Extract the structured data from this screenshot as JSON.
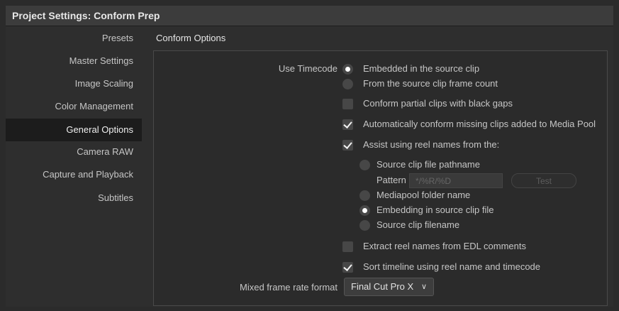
{
  "window": {
    "title": "Project Settings:  Conform Prep"
  },
  "sidebar": {
    "items": [
      {
        "label": "Presets",
        "active": false
      },
      {
        "label": "Master Settings",
        "active": false
      },
      {
        "label": "Image Scaling",
        "active": false
      },
      {
        "label": "Color Management",
        "active": false
      },
      {
        "label": "General Options",
        "active": true
      },
      {
        "label": "Camera RAW",
        "active": false
      },
      {
        "label": "Capture and Playback",
        "active": false
      },
      {
        "label": "Subtitles",
        "active": false
      }
    ]
  },
  "content": {
    "section_title": "Conform Options",
    "use_timecode": {
      "label": "Use Timecode",
      "options": [
        "Embedded in the source clip",
        "From the source clip frame count"
      ],
      "selected": "Embedded in the source clip"
    },
    "conform_partial_clips": {
      "label": "Conform partial clips with black gaps",
      "checked": false
    },
    "auto_conform_missing": {
      "label": "Automatically conform missing clips added to Media Pool",
      "checked": true
    },
    "assist_reel_names": {
      "label": "Assist using reel names from the:",
      "checked": true,
      "options": [
        "Source clip file pathname",
        "Mediapool folder name",
        "Embedding in source clip file",
        "Source clip filename"
      ],
      "selected": "Embedding in source clip file",
      "pattern_label": "Pattern",
      "pattern_value": "*/%R/%D",
      "test_label": "Test"
    },
    "extract_reel_names_edl": {
      "label": "Extract reel names from EDL comments",
      "checked": false
    },
    "sort_timeline": {
      "label": "Sort timeline using reel name and timecode",
      "checked": true
    },
    "mixed_frame_rate": {
      "label": "Mixed frame rate format",
      "value": "Final Cut Pro X",
      "icon": "chevron-down-icon"
    }
  }
}
